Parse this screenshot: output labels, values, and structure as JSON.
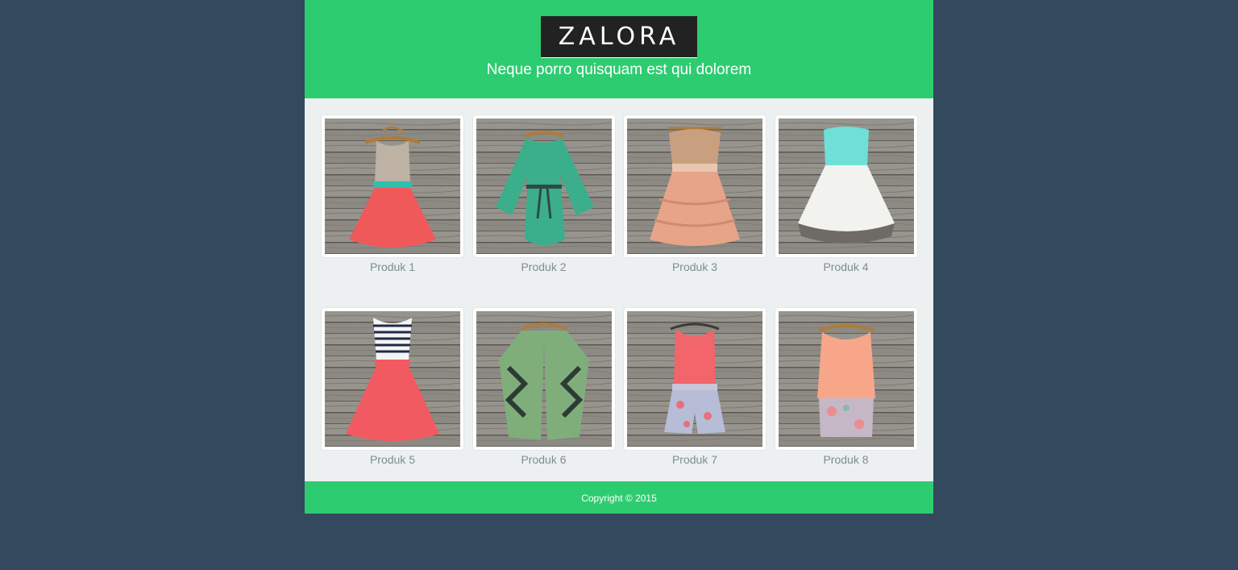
{
  "header": {
    "logo": "ZALORA",
    "tagline": "Neque porro quisquam est qui dolorem"
  },
  "products": [
    {
      "name": "Produk 1",
      "image": "dress-tan-coral-icon"
    },
    {
      "name": "Produk 2",
      "image": "dress-green-icon"
    },
    {
      "name": "Produk 3",
      "image": "dress-sequin-peach-icon"
    },
    {
      "name": "Produk 4",
      "image": "dress-mint-white-icon"
    },
    {
      "name": "Produk 5",
      "image": "dress-striped-coral-icon"
    },
    {
      "name": "Produk 6",
      "image": "cardigan-green-icon"
    },
    {
      "name": "Produk 7",
      "image": "romper-floral-icon"
    },
    {
      "name": "Produk 8",
      "image": "dress-peach-floral-icon"
    }
  ],
  "footer": {
    "copyright": "Copyright © 2015"
  },
  "colors": {
    "background": "#34495e",
    "brand_green": "#2ecc71",
    "content_bg": "#ecf0f1"
  }
}
